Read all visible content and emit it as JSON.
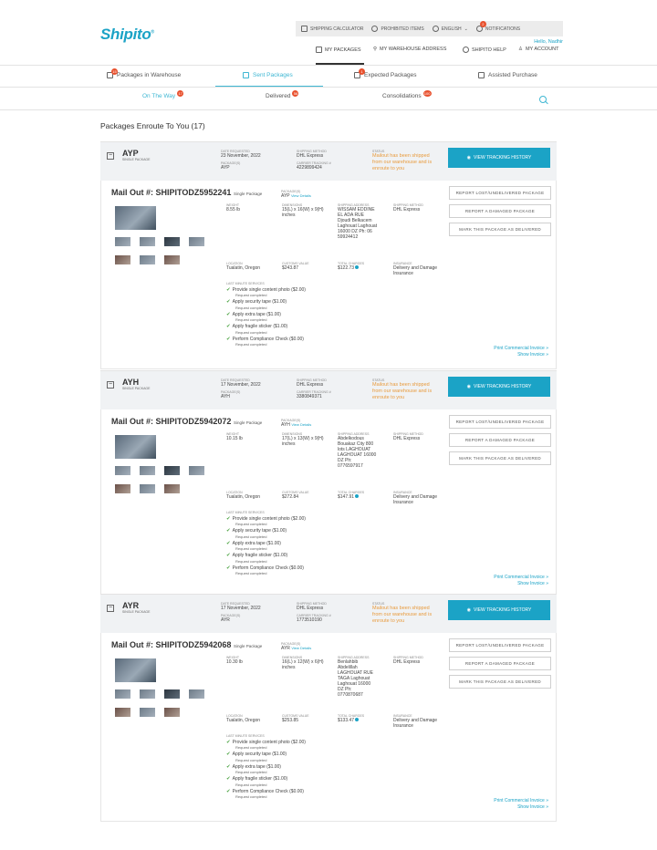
{
  "brand": {
    "logo": "Shipito",
    "registered": "®",
    "accent": "#1ba3c6",
    "alert": "#e8502d"
  },
  "topbar": {
    "shipping_calculator": "SHIPPING CALCULATOR",
    "prohibited_items": "PROHIBITED ITEMS",
    "language": "ENGLISH",
    "notifications": "NOTIFICATIONS",
    "notifications_count": "2"
  },
  "user": {
    "greeting": "Hello, Nadhir"
  },
  "subnav": {
    "my_packages": "MY PACKAGES",
    "warehouse_address": "MY WAREHOUSE ADDRESS",
    "help": "SHIPITO HELP",
    "account": "MY ACCOUNT"
  },
  "main_tabs": [
    {
      "label": "Packages in Warehouse",
      "badge": "15"
    },
    {
      "label": "Sent Packages"
    },
    {
      "label": "Expected Packages",
      "badge": "1"
    },
    {
      "label": "Assisted Purchase"
    }
  ],
  "sub_tabs": [
    {
      "label": "On The Way",
      "badge": "17"
    },
    {
      "label": "Delivered",
      "badge": "56"
    },
    {
      "label": "Consolidations",
      "badge": "100"
    }
  ],
  "page_title": "Packages Enroute To You (17)",
  "labels": {
    "date_requested": "DATE REQUESTED",
    "packages": "PACKAGE(S)",
    "shipping_method": "SHIPPING METHOD",
    "carrier_tracking": "CARRIER TRACKING #",
    "status": "STATUS",
    "view_tracking": "VIEW TRACKING HISTORY",
    "weight": "WEIGHT",
    "dimensions": "DIMENSIONS",
    "shipping_address": "SHIPPING ADDRESS",
    "location": "LOCATION",
    "customs_value": "CUSTOMS VALUE",
    "total_charges": "TOTAL CHARGES",
    "insurance": "INSURANCE",
    "last_minute": "LAST MINUTE SERVICES",
    "report_lost": "REPORT LOST/UNDELIVERED PACKAGE",
    "report_damaged": "REPORT A DAMAGED PACKAGE",
    "mark_delivered": "MARK THIS PACKAGE AS DELIVERED",
    "print_invoice": "Print Commercial Invoice »",
    "show_invoice": "Show Invoice »",
    "view_details": "View Details",
    "mail_out_prefix": "Mail Out #:",
    "single_package": "Single Package",
    "request_completed": "Request completed"
  },
  "services": [
    "Provide single content photo ($2.00)",
    "Apply security tape ($1.00)",
    "Apply extra tape ($1.00)",
    "Apply fragile sticker ($1.00)",
    "Perform Compliance Check ($0.00)"
  ],
  "packages": [
    {
      "code": "AYP",
      "type": "SINGLE PACKAGE",
      "date": "23 November, 2022",
      "pkg": "AYP",
      "method": "DHL Express",
      "tracking": "4229899424",
      "status": "Mailout has been shipped from our warehouse and is enroute to you",
      "mailout": "SHIPITODZ5952241",
      "detail_pkg": "AYP",
      "weight": "8.55 lb",
      "dims": "15(L) x 16(W) x 9(H) inches",
      "address": "WISSAM EDDINE EL ADA RUE Djoudi Belkacem Laghouat Laghouat 16000 DZ Ph: 06 59924412",
      "ship_method": "DHL Express",
      "location": "Tualatin, Oregon",
      "customs": "$243.87",
      "charges": "$122.73",
      "insurance": "Delivery and Damage Insurance"
    },
    {
      "code": "AYH",
      "type": "SINGLE PACKAGE",
      "date": "17 November, 2022",
      "pkg": "AYH",
      "method": "DHL Express",
      "tracking": "3380849371",
      "status": "Mailout has been shipped from our warehouse and is enroute to you",
      "mailout": "SHIPITODZ5942072",
      "detail_pkg": "AYH",
      "weight": "10.15 lb",
      "dims": "17(L) x 13(W) x 9(H) inches",
      "address": "Abdelkodous Bouakaz City 800 lots LAGHOUAT LAGHOUAT 16000 DZ Ph: 0776597917",
      "ship_method": "DHL Express",
      "location": "Tualatin, Oregon",
      "customs": "$272.84",
      "charges": "$147.91",
      "insurance": "Delivery and Damage Insurance"
    },
    {
      "code": "AYR",
      "type": "SINGLE PACKAGE",
      "date": "17 November, 2022",
      "pkg": "AYR",
      "method": "DHL Express",
      "tracking": "1773510190",
      "status": "Mailout has been shipped from our warehouse and is enroute to you",
      "mailout": "SHIPITODZ5942068",
      "detail_pkg": "AYR",
      "weight": "10.30 lb",
      "dims": "16(L) x 12(W) x 6(H) inches",
      "address": "Benlahbib Abdelillah LAGHOUAT RUE TAGA Laghouat Laghouat 16000 DZ Ph: 0770870687",
      "ship_method": "DHL Express",
      "location": "Tualatin, Oregon",
      "customs": "$253.85",
      "charges": "$133.47",
      "insurance": "Delivery and Damage Insurance"
    }
  ]
}
